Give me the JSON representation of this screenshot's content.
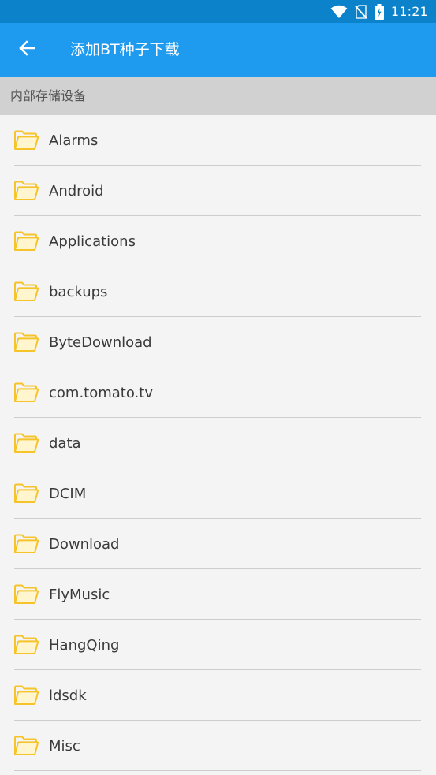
{
  "status_bar": {
    "time": "11:21",
    "icons": [
      "wifi-icon",
      "no-sim-icon",
      "battery-charging-icon"
    ]
  },
  "app_bar": {
    "back_icon": "arrow-left-icon",
    "title": "添加BT种子下载"
  },
  "section": {
    "title": "内部存储设备"
  },
  "folders": [
    {
      "name": "Alarms",
      "icon": "folder-icon"
    },
    {
      "name": "Android",
      "icon": "folder-icon"
    },
    {
      "name": "Applications",
      "icon": "folder-icon"
    },
    {
      "name": "backups",
      "icon": "folder-icon"
    },
    {
      "name": "ByteDownload",
      "icon": "folder-icon"
    },
    {
      "name": "com.tomato.tv",
      "icon": "folder-icon"
    },
    {
      "name": "data",
      "icon": "folder-icon"
    },
    {
      "name": "DCIM",
      "icon": "folder-icon"
    },
    {
      "name": "Download",
      "icon": "folder-icon"
    },
    {
      "name": "FlyMusic",
      "icon": "folder-icon"
    },
    {
      "name": "HangQing",
      "icon": "folder-icon"
    },
    {
      "name": "ldsdk",
      "icon": "folder-icon"
    },
    {
      "name": "Misc",
      "icon": "folder-icon"
    }
  ],
  "colors": {
    "status_bar": "#0b82c9",
    "app_bar": "#1e9bef",
    "section_header": "#d1d1d1",
    "background": "#f4f4f4",
    "folder_stroke": "#f6c428",
    "folder_fill": "#fff6cf"
  }
}
